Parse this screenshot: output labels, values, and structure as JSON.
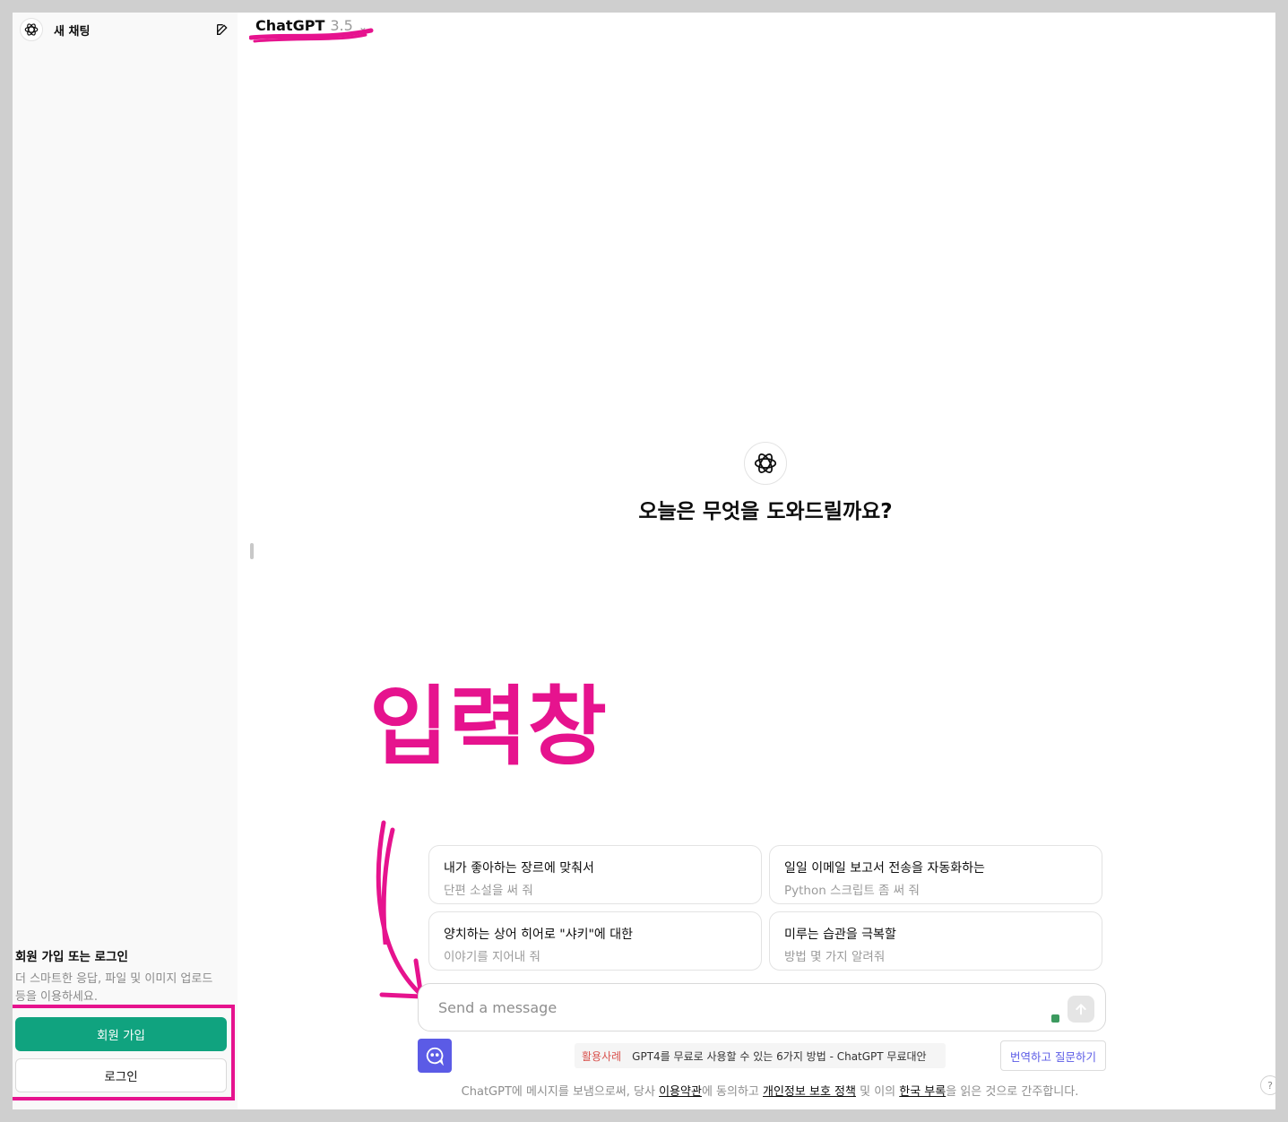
{
  "sidebar": {
    "new_chat_label": "새 채팅",
    "auth_title": "회원 가입 또는 로그인",
    "auth_desc": "더 스마트한 응답, 파일 및 이미지 업로드 등을 이용하세요.",
    "signup_label": "회원 가입",
    "login_label": "로그인"
  },
  "header": {
    "model_name": "ChatGPT",
    "model_version": "3.5"
  },
  "main": {
    "welcome": "오늘은 무엇을 도와드릴까요?",
    "annotation_text": "입력창",
    "suggestions": [
      {
        "title": "내가 좋아하는 장르에 맞춰서",
        "subtitle": "단편 소설을 써 줘"
      },
      {
        "title": "일일 이메일 보고서 전송을 자동화하는",
        "subtitle": "Python 스크립트 좀 써 줘"
      },
      {
        "title": "양치하는 상어 히어로 \"샤키\"에 대한",
        "subtitle": "이야기를 지어내 줘"
      },
      {
        "title": "미루는 습관을 극복할",
        "subtitle": "방법 몇 가지 알려줘"
      }
    ],
    "composer_placeholder": "Send a message"
  },
  "extension": {
    "promo_tag": "활용사례",
    "promo_text": "GPT4를 무료로 사용할 수 있는 6가지 방법 - ChatGPT 무료대안",
    "translate_label": "번역하고 질문하기"
  },
  "footer": {
    "part1": "ChatGPT에 메시지를 보냄으로써, 당사 ",
    "terms": "이용약관",
    "part2": "에 동의하고 ",
    "privacy": "개인정보 보호 정책",
    "part3": " 및 이의 ",
    "korea": "한국 부록",
    "part4": "을 읽은 것으로 간주합니다.",
    "help": "?"
  },
  "colors": {
    "accent_green": "#10a37f",
    "annotation_pink": "#e6138e",
    "extension_purple": "#5b5be6"
  }
}
